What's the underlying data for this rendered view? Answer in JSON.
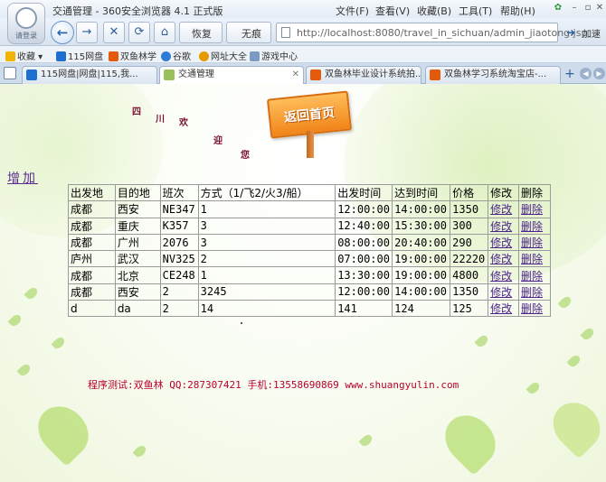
{
  "window": {
    "title": "交通管理 - 360安全浏览器 4.1 正式版",
    "logo_caption": "请登录",
    "menus": [
      "文件(F)",
      "查看(V)",
      "收藏(B)",
      "工具(T)",
      "帮助(H)"
    ]
  },
  "nav": {
    "restore_label": "恢复",
    "noscroll_label": "无痕",
    "url": "http://localhost:8080/travel_in_sichuan/admin_jiaotong.jsp",
    "accel_label": "加速"
  },
  "favorites": [
    "收藏",
    "115网盘",
    "双鱼林学",
    "谷歌",
    "网址大全",
    "游戏中心"
  ],
  "tabs": [
    {
      "label": "115网盘|网盘|115,我...",
      "active": false
    },
    {
      "label": "交通管理",
      "active": true
    },
    {
      "label": "双鱼林毕业设计系统拍...",
      "active": false
    },
    {
      "label": "双鱼林学习系统淘宝店-...",
      "active": false
    }
  ],
  "page": {
    "welcome_chars": [
      "四",
      "川",
      "欢",
      "迎",
      "您"
    ],
    "home_sign": "返回首页",
    "add_link": "增加",
    "table": {
      "headers": [
        "出发地",
        "目的地",
        "班次",
        "方式（1/飞2/火3/船）",
        "出发时间",
        "达到时间",
        "价格",
        "修改",
        "删除"
      ],
      "rows": [
        [
          "成都",
          "西安",
          "NE347",
          "1",
          "12:00:00",
          "14:00:00",
          "1350",
          "修改",
          "删除"
        ],
        [
          "成都",
          "重庆",
          "K357",
          "3",
          "12:40:00",
          "15:30:00",
          "300",
          "修改",
          "删除"
        ],
        [
          "成都",
          "广州",
          "2076",
          "3",
          "08:00:00",
          "20:40:00",
          "290",
          "修改",
          "删除"
        ],
        [
          "庐州",
          "武汉",
          "NV325",
          "2",
          "07:00:00",
          "19:00:00",
          "22220",
          "修改",
          "删除"
        ],
        [
          "成都",
          "北京",
          "CE248",
          "1",
          "13:30:00",
          "19:00:00",
          "4800",
          "修改",
          "删除"
        ],
        [
          "成都",
          "西安",
          "2",
          "3245",
          "12:00:00",
          "14:00:00",
          "1350",
          "修改",
          "删除"
        ],
        [
          "d",
          "da",
          "2",
          "14",
          "141",
          "124",
          "125",
          "修改",
          "删除"
        ]
      ]
    },
    "footer": "程序测试:双鱼林 QQ:287307421 手机:13558690869 www.shuangyulin.com"
  },
  "colors": {
    "link": "#4a238a",
    "footer": "#b8002a",
    "welcome": "#7a1030",
    "sign": "#f08418"
  }
}
